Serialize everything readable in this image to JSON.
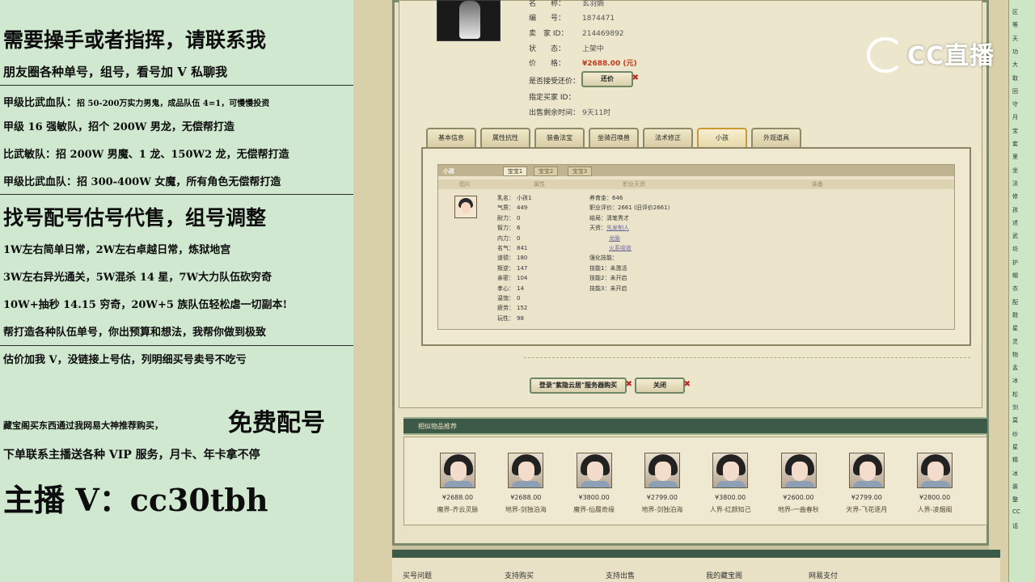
{
  "overlay": {
    "lines": [
      "需要操手或者指挥，请联系我",
      "朋友圈各种单号，组号，看号加 V 私聊我",
      "甲级比武血队：",
      "招 50-200万实力男鬼，成品队伍 4=1，可慢慢投资",
      "甲级 16 强敏队，招个 200W 男龙，无偿帮打造",
      "比武敏队：招 200W 男魔、1 龙、150W2 龙，无偿帮打造",
      "甲级比武血队：招 300-400W 女魔，所有角色无偿帮打造",
      "找号配号估号代售，组号调整",
      "1W左右简单日常，2W左右卓越日常，炼狱地宫",
      "3W左右异光通关，5W混杀 14 星，7W大力队伍砍穷奇",
      "10W+抽秒 14.15 穷奇，20W+5 族队伍轻松虐一切副本!",
      "帮打造各种队伍单号，你出预算和想法，我帮你做到极致",
      "估价加我 V，没链接上号估，列明细买号卖号不吃亏",
      "藏宝阁买东西通过我网易大神推荐购买，",
      "免费配号",
      "下单联系主播送各种 VIP 服务，月卡、年卡拿不停",
      "主播 V：cc30tbh"
    ]
  },
  "item": {
    "fields": [
      {
        "k": "名　　称：",
        "v": "玄羽熵"
      },
      {
        "k": "编　　号：",
        "v": "1874471"
      },
      {
        "k": "卖　家 ID：",
        "v": "214469892"
      },
      {
        "k": "状　　态：",
        "v": "上架中"
      },
      {
        "k": "价　　格：",
        "v": "¥2688.00 (元)"
      }
    ],
    "counter_offer_label": "是否接受还价：",
    "counter_offer_button": "还价",
    "buyer_id_label": "指定买家 ID：",
    "time_left_label": "出售剩余时间：",
    "time_left_value": "9天11时"
  },
  "tabs": [
    "基本信息",
    "属性抗性",
    "装备法宝",
    "坐骑召唤兽",
    "法术修正",
    "小孩",
    "外观道具"
  ],
  "active_tab_index": 5,
  "child_panel": {
    "title": "小孩",
    "subtabs": [
      "宝宝1",
      "宝宝2",
      "宝宝3"
    ],
    "columns": [
      "图片",
      "属性",
      "职业天资",
      "装备"
    ],
    "stats_left": [
      {
        "k": "乳名：",
        "v": "小孩1"
      },
      {
        "k": "气质：",
        "v": "449"
      },
      {
        "k": "耐力：",
        "v": "0"
      },
      {
        "k": "智力：",
        "v": "6"
      },
      {
        "k": "内力：",
        "v": "0"
      },
      {
        "k": "名气：",
        "v": "841"
      },
      {
        "k": "道德：",
        "v": "180"
      },
      {
        "k": "叛逆：",
        "v": "147"
      },
      {
        "k": "亲密：",
        "v": "104"
      },
      {
        "k": "孝心：",
        "v": "14"
      },
      {
        "k": "温饱：",
        "v": "0"
      },
      {
        "k": "疲劳：",
        "v": "152"
      },
      {
        "k": "玩性：",
        "v": "98"
      }
    ],
    "stats_right": [
      {
        "k": "养育金：",
        "v": "646"
      },
      {
        "k": "职业评价：",
        "v": "2661 (旧评价2661)"
      },
      {
        "k": "结局：",
        "v": "清笔秀才"
      },
      {
        "k": "天资：",
        "v": "先发制人"
      },
      {
        "k": "",
        "v": "龙脉"
      },
      {
        "k": "",
        "v": "火系吸收"
      },
      {
        "k": "强化技能：",
        "v": ""
      },
      {
        "k": "技能1：",
        "v": "未激活"
      },
      {
        "k": "技能2：",
        "v": "未开启"
      },
      {
        "k": "技能3：",
        "v": "未开启"
      }
    ]
  },
  "actions": {
    "login_buy": "登录\"紫隐云居\"服务器购买",
    "close": "关闭"
  },
  "recommend": {
    "title": "相似物品推荐",
    "items": [
      {
        "price": "¥2688.00",
        "name": "魔界-齐云灵脉"
      },
      {
        "price": "¥2688.00",
        "name": "地界-剑独泊海"
      },
      {
        "price": "¥3800.00",
        "name": "魔界-仙履奇缘"
      },
      {
        "price": "¥2799.00",
        "name": "地界-剑独泊海"
      },
      {
        "price": "¥3800.00",
        "name": "人界-红颜知己"
      },
      {
        "price": "¥2600.00",
        "name": "地界-一曲春秋"
      },
      {
        "price": "¥2799.00",
        "name": "天界-飞花逐月"
      },
      {
        "price": "¥2800.00",
        "name": "人界-凌烟阁"
      }
    ]
  },
  "bottom_nav": [
    "买号问题",
    "支持购买",
    "支持出售",
    "我的藏宝阁",
    "网易支付"
  ],
  "brand": {
    "name": "CC直播"
  },
  "right_strip": [
    "区",
    "等",
    "天",
    "功",
    "大",
    "取",
    "回",
    "守",
    "月",
    "宝",
    "套",
    "里",
    "坐",
    "法",
    "修",
    "孩",
    "述",
    "武",
    "坊",
    "护",
    "帽",
    "衣",
    "配",
    "鞋",
    "星",
    "灵",
    "物",
    "孟",
    "冰",
    "松",
    "剑",
    "莫",
    "纱",
    "星",
    "精",
    "冰",
    "装",
    "整",
    "CC",
    "话"
  ],
  "colors": {
    "overlay_bg": "#cfe8cf",
    "frame_green": "#3c5a47",
    "price_red": "#c23a1a"
  }
}
